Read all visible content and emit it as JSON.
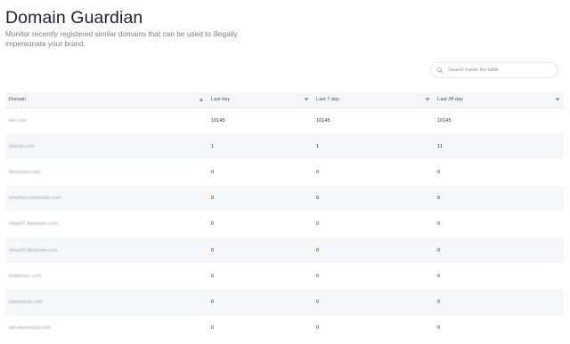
{
  "header": {
    "title": "Domain Guardian",
    "subtitle": "Monitor recently registered similar domains that can be used to illegally impersonate your brand."
  },
  "search": {
    "placeholder": "Search inside the table",
    "value": ""
  },
  "table": {
    "columns": [
      {
        "label": "Domain",
        "sort": "ascending"
      },
      {
        "label": "Last day",
        "sort": "descending"
      },
      {
        "label": "Last 7 day",
        "sort": "descending"
      },
      {
        "label": "Last 28 day",
        "sort": "descending"
      }
    ],
    "rows": [
      {
        "domain": "teo.com",
        "last_day": "10145",
        "last_7_day": "10145",
        "last_28_day": "10145"
      },
      {
        "domain": "lashop.com",
        "last_day": "1",
        "last_7_day": "1",
        "last_28_day": "11"
      },
      {
        "domain": "fibraease.com",
        "last_day": "0",
        "last_7_day": "0",
        "last_28_day": "0"
      },
      {
        "domain": "emailsecuritytester.com",
        "last_day": "0",
        "last_7_day": "0",
        "last_28_day": "0"
      },
      {
        "domain": "relay01.fibraease.com",
        "last_day": "0",
        "last_7_day": "0",
        "last_28_day": "0"
      },
      {
        "domain": "relay02.fibraease.com",
        "last_day": "0",
        "last_7_day": "0",
        "last_28_day": "0"
      },
      {
        "domain": "testdmarc.com",
        "last_day": "0",
        "last_7_day": "0",
        "last_28_day": "0"
      },
      {
        "domain": "easecloud.com",
        "last_day": "0",
        "last_7_day": "0",
        "last_28_day": "0"
      },
      {
        "domain": "spf-easecloud.com",
        "last_day": "0",
        "last_7_day": "0",
        "last_28_day": "0"
      }
    ]
  },
  "colors": {
    "header_bg": "#f5f6f8",
    "stripe_bg": "#f6f7f8",
    "title": "#1e2126",
    "muted_text": "#7a7f87",
    "sort_icon": "#8a9099"
  },
  "icons": {
    "search": "search-icon",
    "sort_ascending": "sort-ascending-icon",
    "sort_descending": "sort-descending-icon"
  }
}
